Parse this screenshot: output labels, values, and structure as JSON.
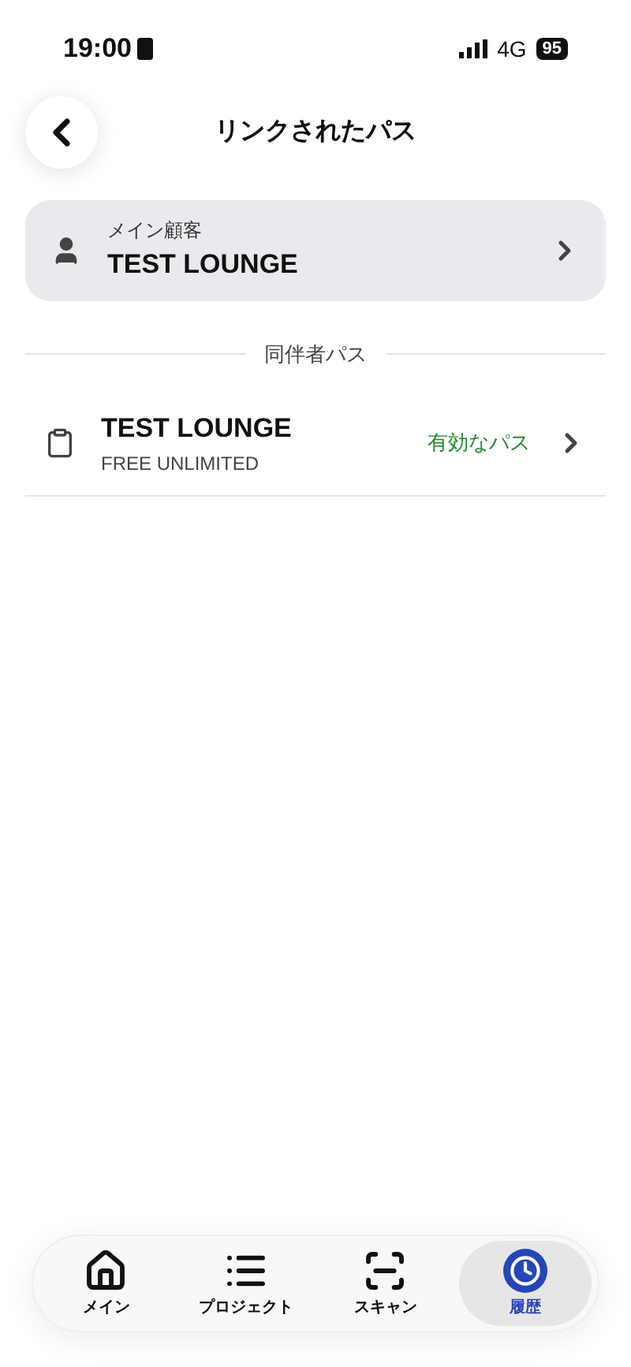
{
  "status_bar": {
    "time": "19:00",
    "network": "4G",
    "battery": "95"
  },
  "header": {
    "title": "リンクされたパス"
  },
  "main_customer": {
    "label": "メイン顧客",
    "name": "TEST LOUNGE"
  },
  "section": {
    "title": "同伴者パス"
  },
  "passes": [
    {
      "name": "TEST LOUNGE",
      "plan": "FREE UNLIMITED",
      "status": "有効なパス",
      "color": "#1f8a2e"
    }
  ],
  "tabs": [
    {
      "label": "メイン",
      "kind": "home",
      "selected": false
    },
    {
      "label": "プロジェクト",
      "kind": "list",
      "selected": false
    },
    {
      "label": "スキャン",
      "kind": "scan",
      "selected": false
    },
    {
      "label": "履歴",
      "kind": "clock",
      "selected": true
    }
  ]
}
